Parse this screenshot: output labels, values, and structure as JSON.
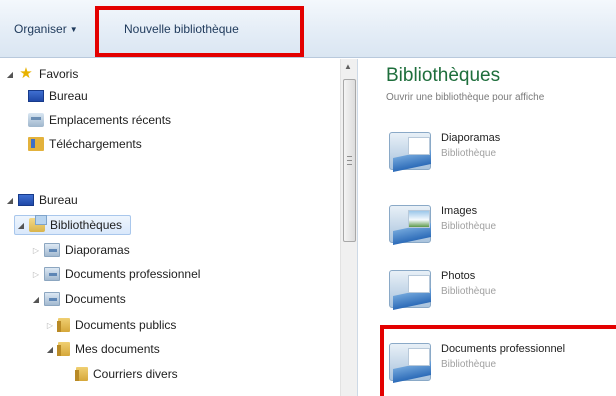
{
  "toolbar": {
    "organise_label": "Organiser",
    "new_library_label": "Nouvelle bibliothèque"
  },
  "nav": {
    "favorites_label": "Favoris",
    "favorites_items": [
      {
        "label": "Bureau",
        "icon": "desktop-icon"
      },
      {
        "label": "Emplacements récents",
        "icon": "recent-places-icon"
      },
      {
        "label": "Téléchargements",
        "icon": "downloads-icon"
      }
    ],
    "desktop_label": "Bureau",
    "libraries_label": "Bibliothèques",
    "library_children": [
      {
        "label": "Diaporamas",
        "icon": "library-icon"
      },
      {
        "label": "Documents professionnel",
        "icon": "library-icon"
      },
      {
        "label": "Documents",
        "icon": "library-icon"
      }
    ],
    "documents_children": [
      {
        "label": "Documents publics",
        "icon": "folder-icon"
      },
      {
        "label": "Mes documents",
        "icon": "folder-icon"
      }
    ],
    "my_documents_children": [
      {
        "label": "Courriers divers",
        "icon": "folder-icon"
      }
    ]
  },
  "content": {
    "title": "Bibliothèques",
    "subtitle": "Ouvrir une bibliothèque pour affiche",
    "libraries": [
      {
        "name": "Diaporamas",
        "type": "Bibliothèque"
      },
      {
        "name": "Images",
        "type": "Bibliothèque"
      },
      {
        "name": "Photos",
        "type": "Bibliothèque"
      },
      {
        "name": "Documents professionnel",
        "type": "Bibliothèque"
      }
    ]
  },
  "colors": {
    "highlight_box": "#e30000",
    "title_green": "#1e6e3c",
    "selection_blue": "#d9e8fb"
  }
}
